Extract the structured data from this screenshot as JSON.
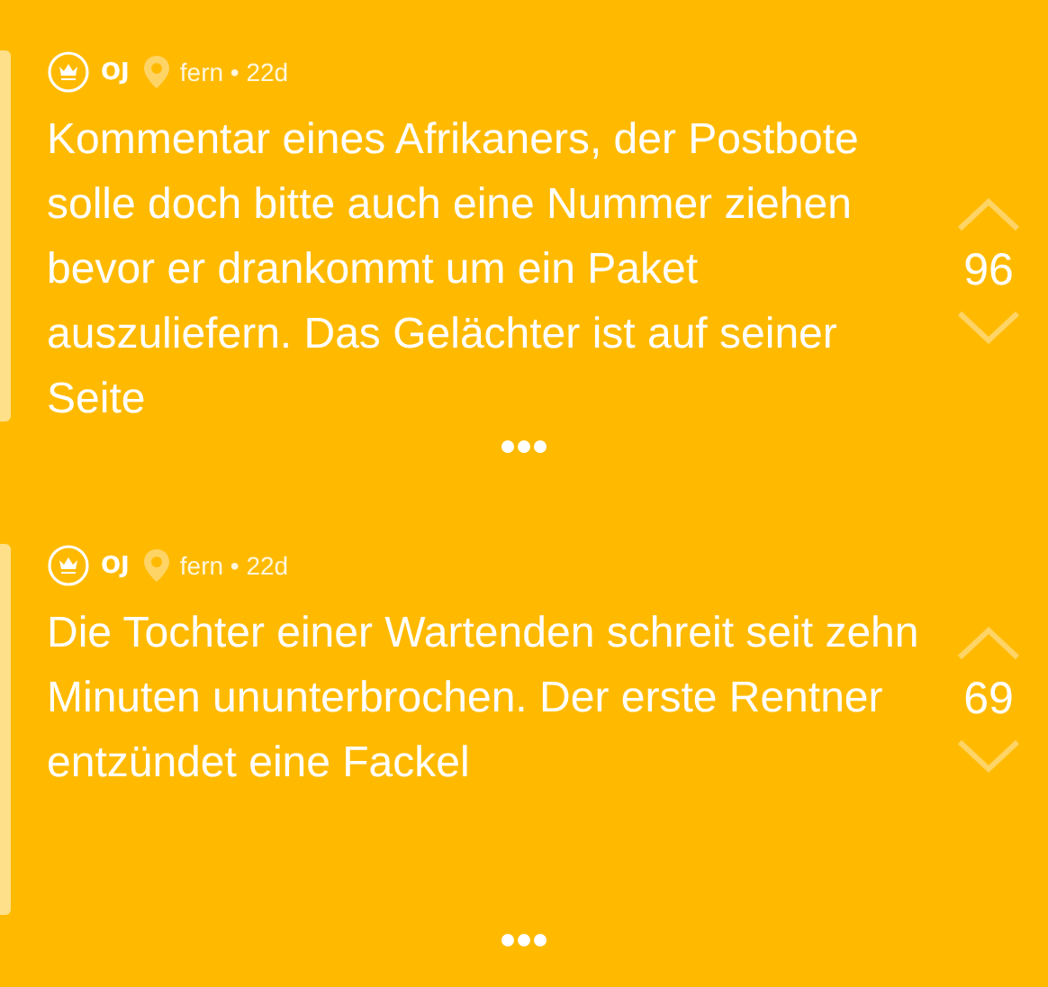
{
  "posts": [
    {
      "author": "OJ",
      "location": "fern",
      "separator": "•",
      "age": "22d",
      "text": "Kommentar eines Afrikaners, der Postbote solle doch bitte auch eine Nummer ziehen bevor er drankommt um ein Paket auszuliefern. Das Gelächter ist auf seiner Seite",
      "votes": "96"
    },
    {
      "author": "OJ",
      "location": "fern",
      "separator": "•",
      "age": "22d",
      "text": "Die Tochter einer Wartenden schreit seit zehn Minuten ununterbrochen. Der erste Rentner entzündet eine Fackel",
      "votes": "69"
    }
  ]
}
